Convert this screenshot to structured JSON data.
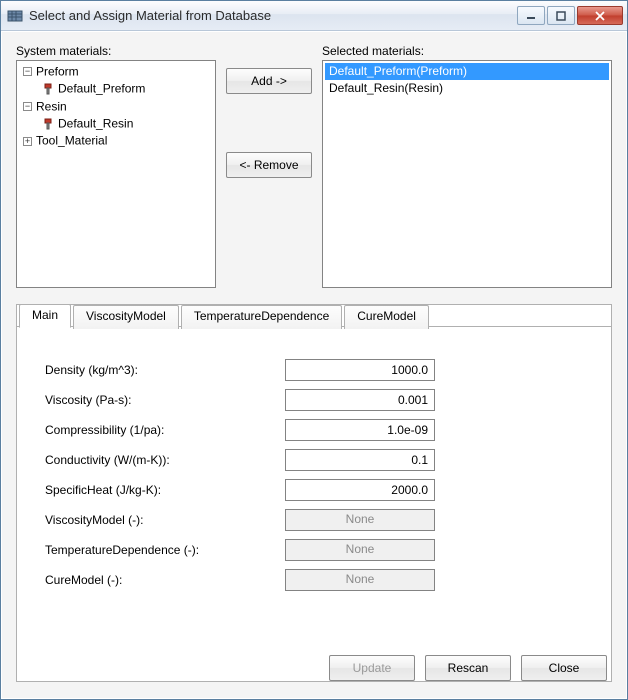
{
  "window": {
    "title": "Select and Assign Material from Database"
  },
  "labels": {
    "system_materials": "System materials:",
    "selected_materials": "Selected materials:"
  },
  "buttons": {
    "add": "Add ->",
    "remove": "<- Remove",
    "update": "Update",
    "rescan": "Rescan",
    "close": "Close"
  },
  "tree": {
    "items": [
      {
        "label": "Preform",
        "expanded": true,
        "children": [
          {
            "label": "Default_Preform",
            "leaf": true
          }
        ]
      },
      {
        "label": "Resin",
        "expanded": true,
        "children": [
          {
            "label": "Default_Resin",
            "leaf": true
          }
        ]
      },
      {
        "label": "Tool_Material",
        "expanded": false,
        "children": []
      }
    ]
  },
  "selected": {
    "items": [
      {
        "label": "Default_Preform(Preform)",
        "selected": true
      },
      {
        "label": "Default_Resin(Resin)",
        "selected": false
      }
    ]
  },
  "tabs": {
    "items": [
      {
        "label": "Main",
        "active": true
      },
      {
        "label": "ViscosityModel",
        "active": false
      },
      {
        "label": "TemperatureDependence",
        "active": false
      },
      {
        "label": "CureModel",
        "active": false
      }
    ]
  },
  "properties": {
    "rows": [
      {
        "label": "Density (kg/m^3):",
        "value": "1000.0",
        "editable": true
      },
      {
        "label": "Viscosity (Pa-s):",
        "value": "0.001",
        "editable": true
      },
      {
        "label": "Compressibility (1/pa):",
        "value": "1.0e-09",
        "editable": true
      },
      {
        "label": "Conductivity (W/(m-K)):",
        "value": "0.1",
        "editable": true
      },
      {
        "label": "SpecificHeat (J/kg-K):",
        "value": "2000.0",
        "editable": true
      },
      {
        "label": "ViscosityModel (-):",
        "value": "None",
        "editable": false
      },
      {
        "label": "TemperatureDependence (-):",
        "value": "None",
        "editable": false
      },
      {
        "label": "CureModel (-):",
        "value": "None",
        "editable": false
      }
    ]
  }
}
